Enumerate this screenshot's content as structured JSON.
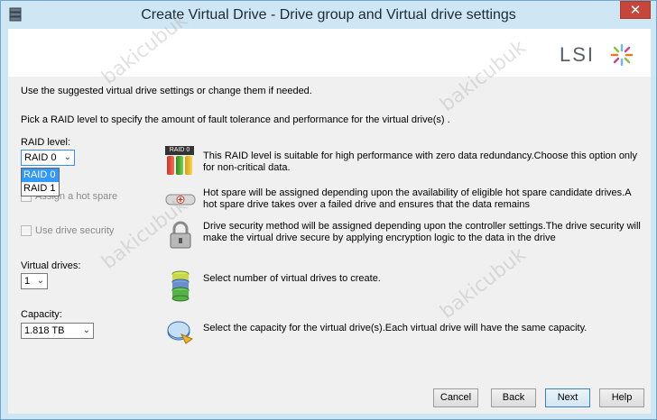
{
  "window": {
    "title": "Create Virtual Drive - Drive group and Virtual drive settings",
    "close_glyph": "✕"
  },
  "brand": {
    "logo_text": "LSI"
  },
  "intro_text": "Use the suggested virtual drive settings or change them if needed.",
  "pick_text": "Pick a RAID level to specify the amount of fault tolerance and performance for the virtual drive(s) .",
  "raid": {
    "label": "RAID level:",
    "selected": "RAID  0",
    "options": [
      "RAID  0",
      "RAID  1"
    ],
    "icon_badge": "RAID 0",
    "description": "This RAID level is suitable for high performance with zero data redundancy.Choose this option only for non-critical data."
  },
  "hot_spare": {
    "label": "Assign a hot spare",
    "description": "Hot spare will be assigned depending upon the availability of eligible hot spare candidate drives.A hot spare drive takes over a failed drive and ensures that the data remains"
  },
  "security": {
    "label": "Use drive security",
    "description": "Drive security method will be assigned depending upon the controller settings.The drive security will make the virtual drive secure by applying encryption logic to the data in the drive"
  },
  "virtual_drives": {
    "label": "Virtual drives:",
    "value": "1",
    "description": "Select number of virtual drives to create."
  },
  "capacity": {
    "label": "Capacity:",
    "value": "1.818 TB",
    "description": "Select the capacity for the virtual drive(s).Each virtual drive will have the same capacity."
  },
  "buttons": {
    "cancel": "Cancel",
    "back": "Back",
    "next": "Next",
    "help": "Help"
  },
  "watermark": "bakicubuk"
}
